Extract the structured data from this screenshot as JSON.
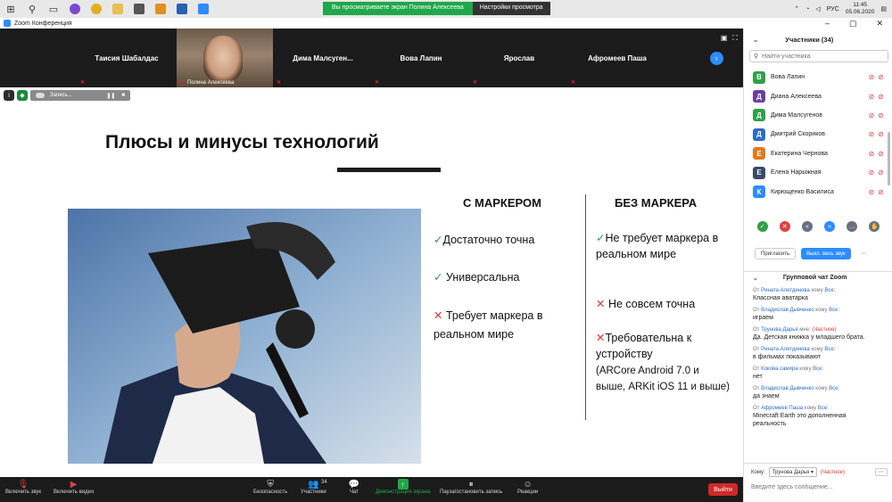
{
  "taskbar": {
    "share_banner": "Вы просматриваете экран Полина Алексеева",
    "view_options": "Настройки просмотра",
    "lang": "РУС",
    "time": "11:45",
    "date": "05.06.2020"
  },
  "window": {
    "title": "Zoom Конференция"
  },
  "participants_strip": [
    {
      "name": "Таисия Шабалдас"
    },
    {
      "name": "Полина Алексеева",
      "video": true
    },
    {
      "name": "Дима Малсуген..."
    },
    {
      "name": "Вова Лапин"
    },
    {
      "name": "Ярослав"
    },
    {
      "name": "Афромеев Паша"
    }
  ],
  "recording": {
    "label": "Запись..."
  },
  "slide": {
    "title": "Плюсы и минусы технологий",
    "col1_head": "С МАРКЕРОМ",
    "col2_head": "БЕЗ МАРКЕРА",
    "col1_items": [
      {
        "mark": "✓",
        "text": "Достаточно точна",
        "good": true
      },
      {
        "mark": "✓",
        "text": "Универсальна",
        "good": true
      },
      {
        "mark": "✕",
        "text": "Требует маркера в реальном мире",
        "good": false
      }
    ],
    "col2_items": [
      {
        "mark": "✓",
        "text": "Не требует маркера в реальном мире",
        "good": true
      },
      {
        "mark": "✕",
        "text": "Не совсем точна",
        "good": false
      },
      {
        "mark": "✕",
        "text": "Требовательна к устройству",
        "good": false
      }
    ],
    "col2_note": "(ARCore Android 7.0 и выше, ARKit iOS 11 и выше)"
  },
  "toolbar": {
    "mute": "Включить звук",
    "video": "Включить видео",
    "security": "Безопасность",
    "participants": "Участники",
    "participants_count": "34",
    "chat": "Чат",
    "share": "Демонстрация экрана",
    "record": "Пауза/остановить запись",
    "reactions": "Реакции",
    "leave": "Выйти"
  },
  "panel": {
    "title": "Участники (34)",
    "search_placeholder": "Найти участника",
    "participants": [
      {
        "initial": "В",
        "name": "Вова Лапин",
        "color": "#2fa04a"
      },
      {
        "initial": "Д",
        "name": "Диана Алексеева",
        "color": "#6b3fa0"
      },
      {
        "initial": "Д",
        "name": "Дима Малсугенов",
        "color": "#2fa04a"
      },
      {
        "initial": "Д",
        "name": "Дмитрий Скориков",
        "color": "#2d6cc4"
      },
      {
        "initial": "Е",
        "name": "Екатерина Чернова",
        "color": "#e07a20"
      },
      {
        "initial": "Е",
        "name": "Елена Нарыжная",
        "color": "#3a4a6a"
      },
      {
        "initial": "К",
        "name": "Кирющенко Василиса",
        "color": "#2d8cff"
      }
    ],
    "invite": "Пригласить",
    "mute_all": "Выкл. весь звук",
    "chat_title": "Групповой чат Zoom",
    "messages": [
      {
        "from": "От",
        "name": "Рината Алетдинова",
        "to": "кому",
        "target": "Все:",
        "text": "Классная аватарка"
      },
      {
        "from": "От",
        "name": "Владислав Дывченко",
        "to": "кому",
        "target": "Все:",
        "text": "играем"
      },
      {
        "from": "От",
        "name": "Трунова Дарья",
        "to": "мне:",
        "target": "(Частное)",
        "text": "Да. Детская книжка у младшего брата.",
        "private": true
      },
      {
        "from": "От",
        "name": "Рината Алетдинова",
        "to": "кому",
        "target": "Все:",
        "text": "в фильмах показывают"
      },
      {
        "from": "От",
        "name": "Кокова самира",
        "to": "кому",
        "target": "Все:",
        "text": "нет"
      },
      {
        "from": "От",
        "name": "Владислав Дывченко",
        "to": "кому",
        "target": "Все:",
        "text": "да знаем"
      },
      {
        "from": "От",
        "name": "Афромеев Паша",
        "to": "кому",
        "target": "Все:",
        "text": "Minecraft Earth это дополненная реальность"
      }
    ],
    "to_label": "Кому:",
    "to_value": "Трунова Дарья ▾",
    "to_private": "(Частное)",
    "input_placeholder": "Введите здесь сообщение..."
  }
}
